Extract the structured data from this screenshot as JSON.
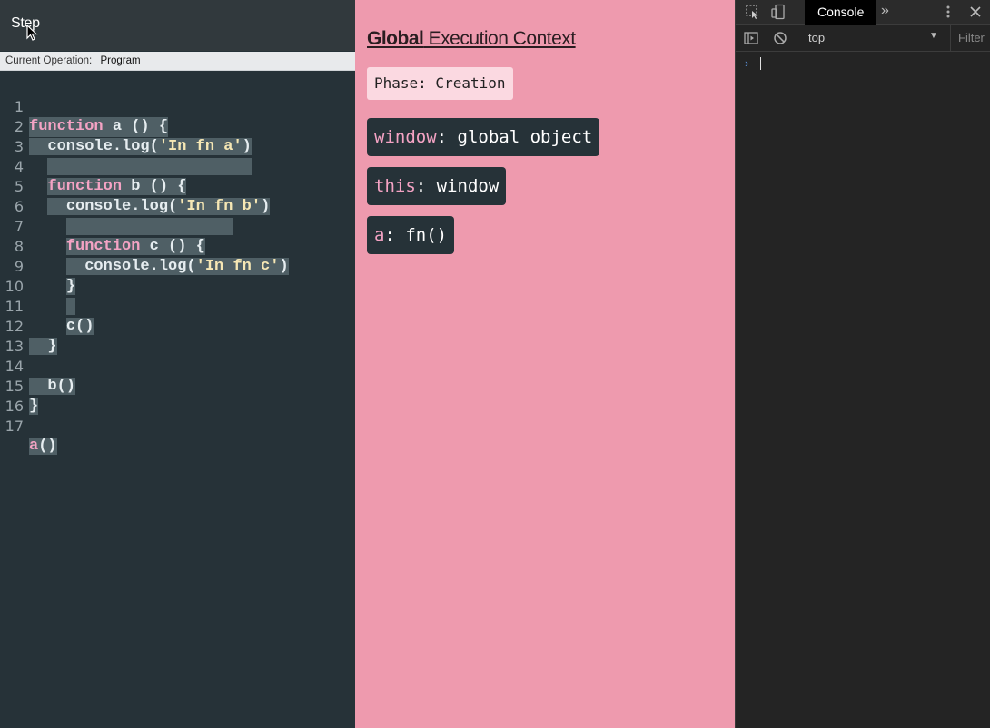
{
  "toolbar": {
    "step_label": "Step"
  },
  "operation": {
    "label": "Current Operation:",
    "value": "Program"
  },
  "editor": {
    "lines": [
      {
        "n": "1"
      },
      {
        "n": "2"
      },
      {
        "n": "3"
      },
      {
        "n": "4"
      },
      {
        "n": "5"
      },
      {
        "n": "6"
      },
      {
        "n": "7"
      },
      {
        "n": "8"
      },
      {
        "n": "9"
      },
      {
        "n": "10"
      },
      {
        "n": "11"
      },
      {
        "n": "12"
      },
      {
        "n": "13"
      },
      {
        "n": "14"
      },
      {
        "n": "15"
      },
      {
        "n": "16"
      },
      {
        "n": "17"
      }
    ],
    "tokens": {
      "kw_function": "function",
      "a_decl": " a () {",
      "console_a": "console.log(",
      "str_a": "'In fn a'",
      "close_paren": ")",
      "b_decl": " b () {",
      "str_b": "'In fn b'",
      "c_decl": " c () {",
      "str_c": "'In fn c'",
      "brace": "}",
      "c_call": "c()",
      "b_call": "b()",
      "a_name": "a",
      "a_parens": "()"
    }
  },
  "context": {
    "title_bold": "Global",
    "title_rest": " Execution Context",
    "phase": "Phase: Creation",
    "vars": [
      {
        "name": "window",
        "value": ": global object"
      },
      {
        "name": "this",
        "value": ": window"
      },
      {
        "name": "a",
        "value": ": fn()"
      }
    ]
  },
  "devtools": {
    "tab_console": "Console",
    "more_tabs": "»",
    "context": "top",
    "context_arrow": "▼",
    "filter_placeholder": "Filter",
    "prompt": "›"
  },
  "colors": {
    "editor_bg": "#263238",
    "context_bg": "#ee9aae",
    "keyword": "#f4a3c4",
    "string": "#f6e7b4",
    "devtools_bg": "#242424"
  }
}
